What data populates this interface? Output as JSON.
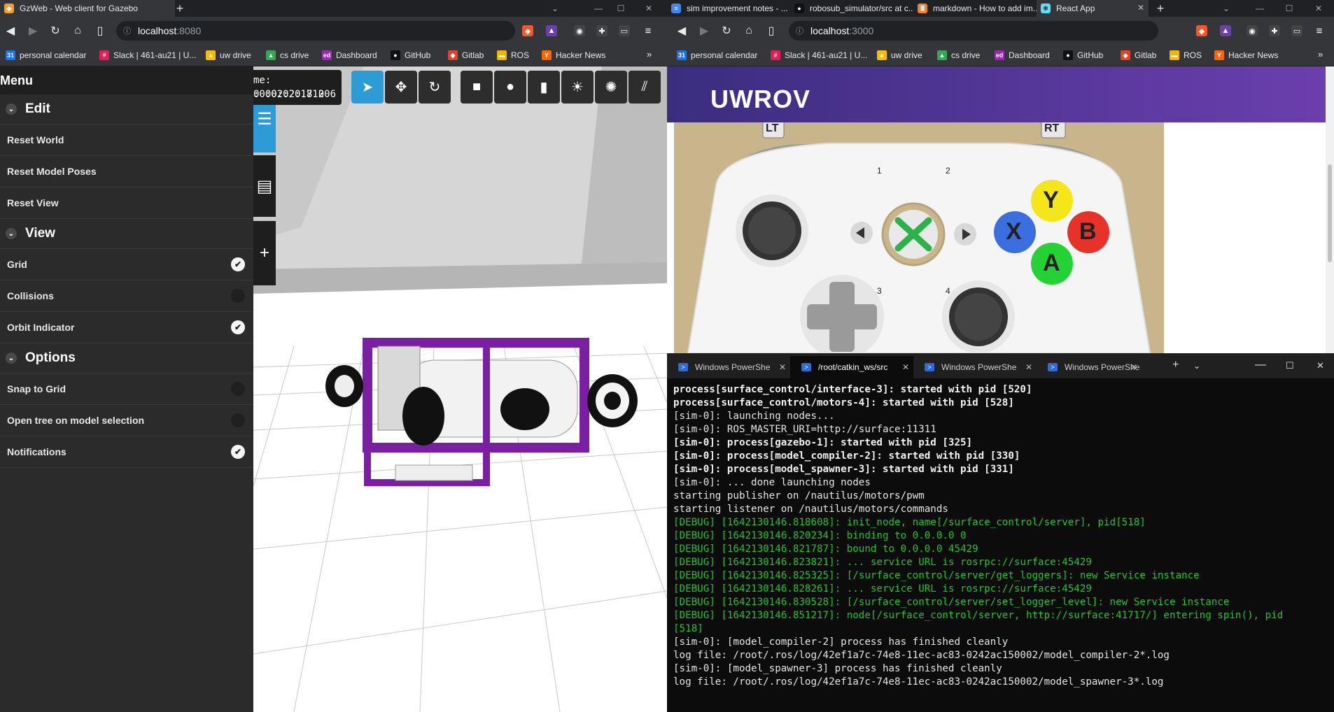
{
  "left_browser": {
    "tabs": [
      {
        "title": "GzWeb - Web client for Gazebo",
        "active": true
      }
    ],
    "url": {
      "host": "localhost",
      "port": ":8080"
    },
    "bookmarks": [
      "personal calendar",
      "Slack | 461-au21 | U...",
      "uw drive",
      "cs drive",
      "Dashboard",
      "GitHub",
      "Gitlab",
      "ROS",
      "Hacker News"
    ],
    "bookmarks_more": "»"
  },
  "right_browser": {
    "tabs": [
      {
        "title": "sim improvement notes - ..."
      },
      {
        "title": "robosub_simulator/src at c..."
      },
      {
        "title": "markdown - How to add im..."
      },
      {
        "title": "React App",
        "active": true
      }
    ],
    "url": {
      "host": "localhost",
      "port": ":3000"
    },
    "bookmarks": [
      "personal calendar",
      "Slack | 461-au21 | U...",
      "uw drive",
      "cs drive",
      "Dashboard",
      "GitHub",
      "Gitlab",
      "ROS",
      "Hacker News"
    ],
    "bookmarks_more": "»"
  },
  "gzweb": {
    "menu_title": "Menu",
    "sections": [
      {
        "title": "Edit",
        "items": [
          {
            "label": "Reset World"
          },
          {
            "label": "Reset Model Poses"
          },
          {
            "label": "Reset View"
          }
        ]
      },
      {
        "title": "View",
        "items": [
          {
            "label": "Grid",
            "checked": true
          },
          {
            "label": "Collisions",
            "checked": false
          },
          {
            "label": "Orbit Indicator",
            "checked": true
          }
        ]
      },
      {
        "title": "Options",
        "items": [
          {
            "label": "Snap to Grid",
            "checked": false
          },
          {
            "label": "Open tree on model selection",
            "checked": false
          },
          {
            "label": "Notifications",
            "checked": true
          }
        ]
      }
    ],
    "sim_time": "me: 00:02:20.710",
    "real_time": ": 00:02:18.206",
    "tool_icons": [
      "select-arrow-icon",
      "translate-icon",
      "rotate-icon",
      "box-icon",
      "sphere-icon",
      "cylinder-icon",
      "sun-icon",
      "spot-light-icon",
      "directional-light-icon"
    ],
    "check_mark": "✔"
  },
  "react_app": {
    "title": "UWROV",
    "controller": {
      "lt": "LT",
      "rt": "RT",
      "y": "Y",
      "x": "X",
      "b": "B",
      "a": "A",
      "quadrants": [
        "1",
        "2",
        "3",
        "4"
      ],
      "colors": {
        "y": "#f5e61a",
        "x": "#3b6fe0",
        "b": "#e63228",
        "a": "#25d235",
        "guide": "#2bb34a",
        "background": "#c9b58b"
      }
    }
  },
  "terminal": {
    "tabs": [
      {
        "title": "Windows PowerShe"
      },
      {
        "title": "/root/catkin_ws/src",
        "active": true
      },
      {
        "title": "Windows PowerShe"
      },
      {
        "title": "Windows PowerShe"
      }
    ],
    "lines": [
      {
        "text": "process[surface_control/interface-3]: started with pid [520]",
        "style": "bold"
      },
      {
        "text": "process[surface_control/motors-4]: started with pid [528]",
        "style": "bold"
      },
      {
        "text": "[sim-0]: launching nodes...",
        "style": "normal"
      },
      {
        "text": "[sim-0]: ROS_MASTER_URI=http://surface:11311",
        "style": "normal"
      },
      {
        "text": "[sim-0]: process[gazebo-1]: started with pid [325]",
        "style": "bold"
      },
      {
        "text": "[sim-0]: process[model_compiler-2]: started with pid [330]",
        "style": "bold"
      },
      {
        "text": "[sim-0]: process[model_spawner-3]: started with pid [331]",
        "style": "bold"
      },
      {
        "text": "[sim-0]: ... done launching nodes",
        "style": "normal"
      },
      {
        "text": "starting publisher on /nautilus/motors/pwm",
        "style": "normal"
      },
      {
        "text": "starting listener on /nautilus/motors/commands",
        "style": "normal"
      },
      {
        "text": "[DEBUG] [1642130146.818608]: init_node, name[/surface_control/server], pid[518]",
        "style": "debug"
      },
      {
        "text": "[DEBUG] [1642130146.820234]: binding to 0.0.0.0 0",
        "style": "debug"
      },
      {
        "text": "[DEBUG] [1642130146.821787]: bound to 0.0.0.0 45429",
        "style": "debug"
      },
      {
        "text": "[DEBUG] [1642130146.823821]: ... service URL is rosrpc://surface:45429",
        "style": "debug"
      },
      {
        "text": "[DEBUG] [1642130146.825325]: [/surface_control/server/get_loggers]: new Service instance",
        "style": "debug"
      },
      {
        "text": "[DEBUG] [1642130146.828261]: ... service URL is rosrpc://surface:45429",
        "style": "debug"
      },
      {
        "text": "[DEBUG] [1642130146.830528]: [/surface_control/server/set_logger_level]: new Service instance",
        "style": "debug"
      },
      {
        "text": "[DEBUG] [1642130146.851217]: node[/surface_control/server, http://surface:41717/] entering spin(), pid",
        "style": "debug"
      },
      {
        "text": "[518]",
        "style": "debug"
      },
      {
        "text": "[sim-0]: [model_compiler-2] process has finished cleanly",
        "style": "normal"
      },
      {
        "text": "log file: /root/.ros/log/42ef1a7c-74e8-11ec-ac83-0242ac150002/model_compiler-2*.log",
        "style": "normal"
      },
      {
        "text": "[sim-0]: [model_spawner-3] process has finished cleanly",
        "style": "normal"
      },
      {
        "text": "log file: /root/.ros/log/42ef1a7c-74e8-11ec-ac83-0242ac150002/model_spawner-3*.log",
        "style": "normal"
      }
    ]
  }
}
